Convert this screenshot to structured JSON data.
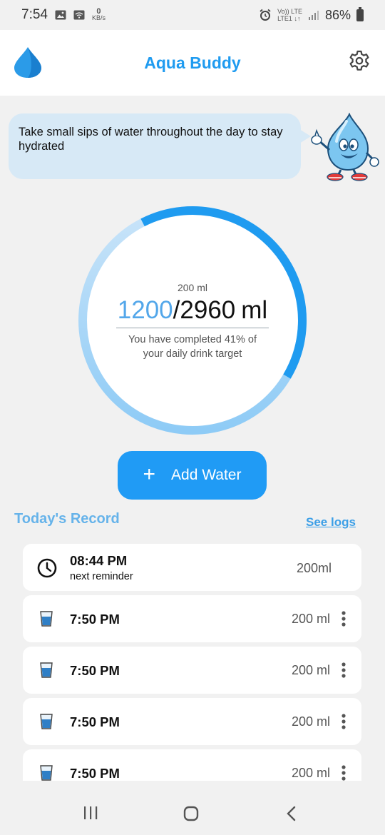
{
  "status_bar": {
    "time": "7:54",
    "network_speed_value": "0",
    "network_speed_unit": "KB/s",
    "volte_label": "Vo))",
    "lte_label": "LTE",
    "lte1_label": "LTE1",
    "battery": "86%"
  },
  "app_bar": {
    "title": "Aqua Buddy",
    "logo_icon": "water-drop-icon",
    "settings_icon": "gear-icon"
  },
  "tip": {
    "text": "Take small sips of water throughout the day to stay hydrated"
  },
  "progress": {
    "glass_size": "200 ml",
    "current": "1200",
    "separator": "/",
    "target": "2960",
    "unit": "ml",
    "completed_text": "You have completed 41% of your daily drink target",
    "fraction": 0.41
  },
  "add_button": {
    "icon": "plus-icon",
    "label": "Add Water"
  },
  "record": {
    "title": "Today's Record",
    "see_logs": "See logs",
    "reminder": {
      "time": "08:44 PM",
      "label": "next reminder",
      "amount": "200ml"
    },
    "entries": [
      {
        "time": "7:50 PM",
        "amount": "200 ml"
      },
      {
        "time": "7:50 PM",
        "amount": "200 ml"
      },
      {
        "time": "7:50 PM",
        "amount": "200 ml"
      },
      {
        "time": "7:50 PM",
        "amount": "200 ml"
      }
    ]
  },
  "colors": {
    "accent": "#1f9bf0",
    "ring_progress": "#1f9bf0",
    "ring_track": "#a9d6f8",
    "background": "#f1f1f1"
  }
}
